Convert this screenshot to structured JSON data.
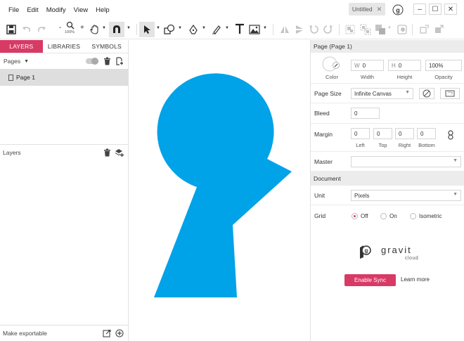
{
  "menu": [
    "File",
    "Edit",
    "Modify",
    "View",
    "Help"
  ],
  "tab": {
    "title": "Untitled",
    "close": "✕"
  },
  "window": {
    "minimize": "–",
    "maximize": "☐",
    "close": "✕"
  },
  "toolbar": {
    "zoom_minus": "-",
    "zoom_plus": "+",
    "zoom_level": "100%"
  },
  "left_panel": {
    "tabs": [
      "LAYERS",
      "LIBRARIES",
      "SYMBOLS"
    ],
    "pages_label": "Pages",
    "page_items": [
      "Page 1"
    ],
    "layers_label": "Layers",
    "export_label": "Make exportable"
  },
  "right_panel": {
    "page_header": "Page (Page 1)",
    "color_label": "Color",
    "width_prefix": "W",
    "width_value": "0",
    "width_label": "Width",
    "height_prefix": "H",
    "height_value": "0",
    "height_label": "Height",
    "opacity_value": "100%",
    "opacity_label": "Opacity",
    "page_size_label": "Page Size",
    "page_size_value": "Infinite Canvas",
    "bleed_label": "Bleed",
    "bleed_value": "0",
    "margin_label": "Margin",
    "margins": [
      {
        "value": "0",
        "label": "Left"
      },
      {
        "value": "0",
        "label": "Top"
      },
      {
        "value": "0",
        "label": "Right"
      },
      {
        "value": "0",
        "label": "Bottom"
      }
    ],
    "master_label": "Master",
    "document_header": "Document",
    "unit_label": "Unit",
    "unit_value": "Pixels",
    "grid_label": "Grid",
    "grid_options": [
      "Off",
      "On",
      "Isometric"
    ],
    "grid_selected": "Off",
    "brand_name": "gravit",
    "brand_sub": "cloud",
    "sync_button": "Enable Sync",
    "learn_more": "Learn more"
  },
  "colors": {
    "accent": "#d83a66",
    "shape_fill": "#00a2e8"
  }
}
